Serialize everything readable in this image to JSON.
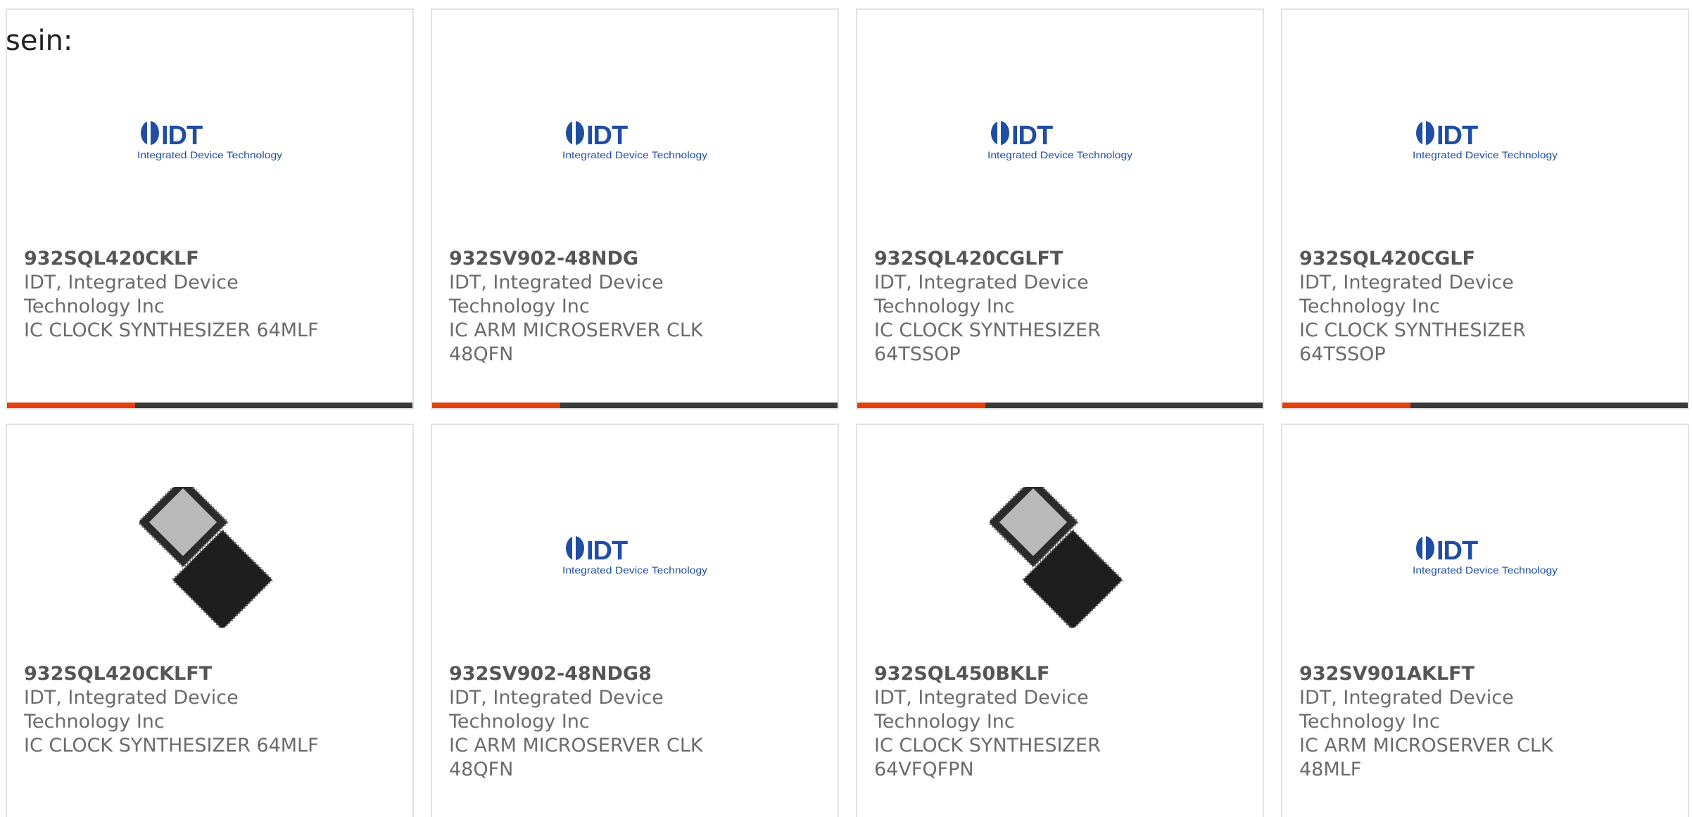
{
  "intro_text": "sein:",
  "colors": {
    "accent": "#e0410e",
    "bar": "#3a3a3a",
    "idt_blue": "#1f4ea3"
  },
  "logo": {
    "brand": "IDT",
    "tagline": "Integrated Device Technology"
  },
  "products": [
    {
      "part_number": "932SQL420CKLF",
      "manufacturer": "IDT, Integrated Device Technology Inc",
      "description": "IC CLOCK SYNTHESIZER 64MLF",
      "image": "idt-logo",
      "show_bar": true
    },
    {
      "part_number": "932SV902-48NDG",
      "manufacturer": "IDT, Integrated Device Technology Inc",
      "description": "IC ARM MICROSERVER CLK 48QFN",
      "image": "idt-logo",
      "show_bar": true
    },
    {
      "part_number": "932SQL420CGLFT",
      "manufacturer": "IDT, Integrated Device Technology Inc",
      "description": "IC CLOCK SYNTHESIZER 64TSSOP",
      "image": "idt-logo",
      "show_bar": true
    },
    {
      "part_number": "932SQL420CGLF",
      "manufacturer": "IDT, Integrated Device Technology Inc",
      "description": "IC CLOCK SYNTHESIZER 64TSSOP",
      "image": "idt-logo",
      "show_bar": true
    },
    {
      "part_number": "932SQL420CKLFT",
      "manufacturer": "IDT, Integrated Device Technology Inc",
      "description": "IC CLOCK SYNTHESIZER 64MLF",
      "image": "chip-photo",
      "show_bar": false
    },
    {
      "part_number": "932SV902-48NDG8",
      "manufacturer": "IDT, Integrated Device Technology Inc",
      "description": "IC ARM MICROSERVER CLK 48QFN",
      "image": "idt-logo",
      "show_bar": false
    },
    {
      "part_number": "932SQL450BKLF",
      "manufacturer": "IDT, Integrated Device Technology Inc",
      "description": "IC CLOCK SYNTHESIZER 64VFQFPN",
      "image": "chip-photo",
      "show_bar": false
    },
    {
      "part_number": "932SV901AKLFT",
      "manufacturer": "IDT, Integrated Device Technology Inc",
      "description": "IC ARM MICROSERVER CLK 48MLF",
      "image": "idt-logo",
      "show_bar": false
    }
  ]
}
